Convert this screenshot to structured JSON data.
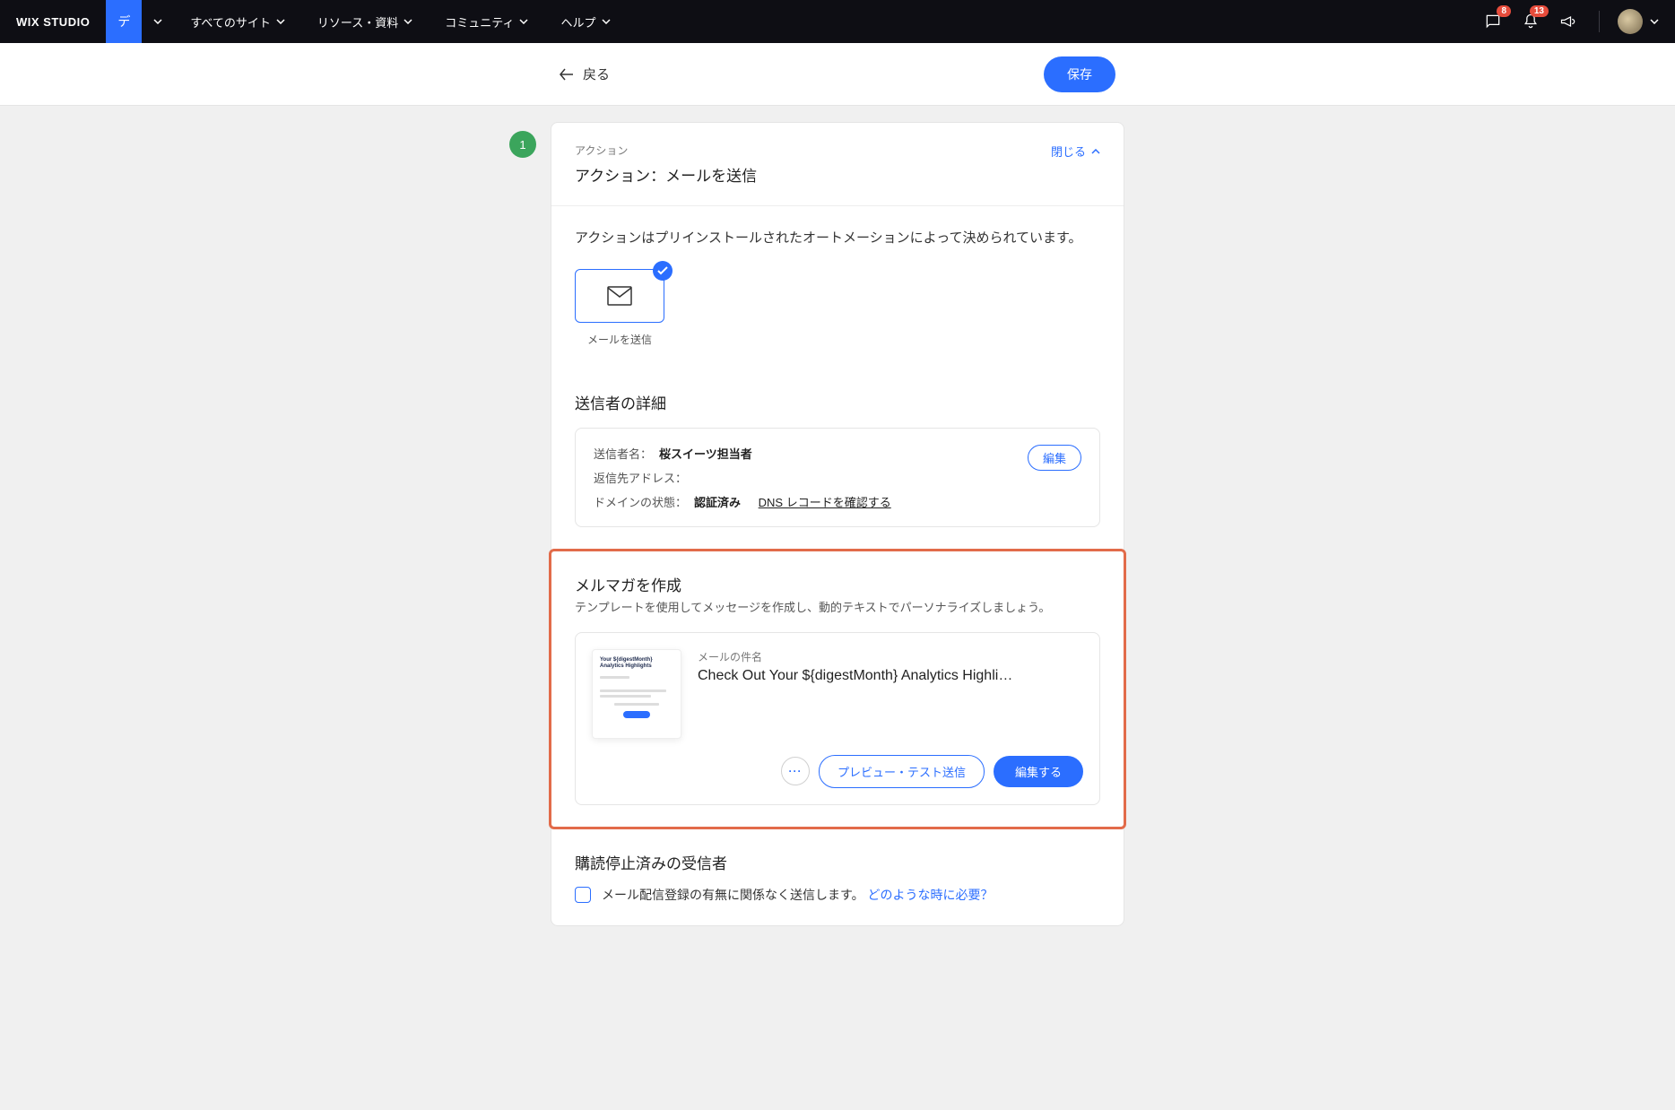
{
  "topbar": {
    "logo_strong": "WIX",
    "logo_light": "STUDIO",
    "site_initial": "デ",
    "nav": {
      "all_sites": "すべてのサイト",
      "resources": "リソース・資料",
      "community": "コミュニティ",
      "help": "ヘルプ"
    },
    "badges": {
      "chat": "8",
      "bell": "13"
    }
  },
  "subbar": {
    "back": "戻る",
    "save": "保存"
  },
  "step": "1",
  "action_card": {
    "eyebrow": "アクション",
    "title": "アクション：メールを送信",
    "close": "閉じる",
    "description": "アクションはプリインストールされたオートメーションによって決められています。",
    "tile_label": "メールを送信"
  },
  "sender": {
    "section_title": "送信者の詳細",
    "name_label": "送信者名：",
    "name_value": "桜スイーツ担当者",
    "reply_label": "返信先アドレス：",
    "reply_value": " ",
    "domain_label": "ドメインの状態：",
    "domain_value": "認証済み",
    "dns_link": "DNS レコードを確認する",
    "edit": "編集"
  },
  "compose": {
    "title": "メルマガを作成",
    "subtitle": "テンプレートを使用してメッセージを作成し、動的テキストでパーソナライズしましょう。",
    "thumb_title": "Your ${digestMonth} Analytics Highlights",
    "subject_label": "メールの件名",
    "subject_value": "Check Out Your ${digestMonth} Analytics Highli…",
    "more": "···",
    "preview": "プレビュー・テスト送信",
    "edit": "編集する"
  },
  "unsub": {
    "title": "購読停止済みの受信者",
    "checkbox_text": "メール配信登録の有無に関係なく送信します。",
    "help": "どのような時に必要？"
  }
}
